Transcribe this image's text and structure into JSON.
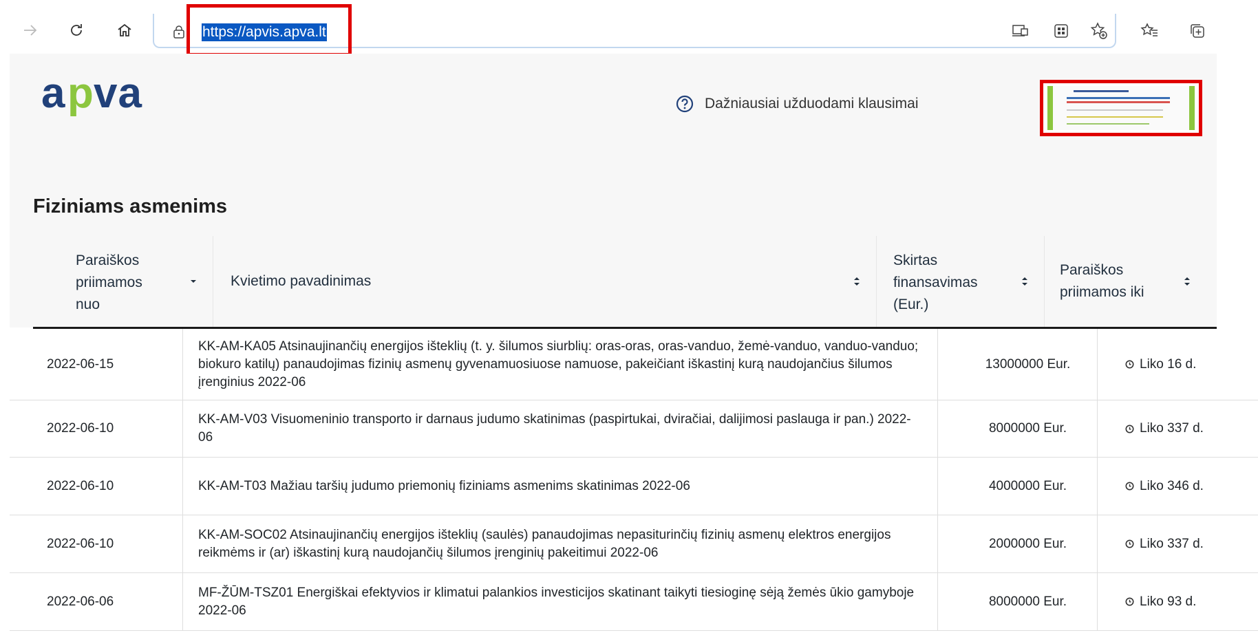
{
  "browser": {
    "url": "https://apvis.apva.lt",
    "icons": [
      "forward-arrow-icon",
      "refresh-icon",
      "home-icon",
      "lock-icon",
      "app-available-icon",
      "qr-code-icon",
      "add-favorite-icon",
      "favorites-icon",
      "collections-icon"
    ]
  },
  "header": {
    "logo_text": "apva",
    "faq_label": "Dažniausiai užduodami klausimai"
  },
  "section": {
    "title": "Fiziniams asmenims"
  },
  "table": {
    "columns": [
      {
        "l1": "Paraiškos",
        "l2": "priimamos",
        "l3": "nuo"
      },
      {
        "l1": "Kvietimo pavadinimas"
      },
      {
        "l1": "Skirtas",
        "l2": "finansavimas",
        "l3": "(Eur.)"
      },
      {
        "l1": "Paraiškos",
        "l2": "priimamos iki"
      }
    ],
    "rows": [
      {
        "date": "2022-06-15",
        "name": "KK-AM-KA05 Atsinaujinančių energijos išteklių (t. y. šilumos siurblių: oras-oras, oras-vanduo, žemė-vanduo, vanduo-vanduo; biokuro katilų) panaudojimas fizinių asmenų gyvenamuosiuose namuose, pakeičiant iškastinį kurą naudojančius šilumos įrenginius 2022-06",
        "funding": "13000000 Eur.",
        "left": "Liko 16 d."
      },
      {
        "date": "2022-06-10",
        "name": "KK-AM-V03 Visuomeninio transporto ir darnaus judumo skatinimas (paspirtukai, dviračiai, dalijimosi paslauga ir pan.) 2022-06",
        "funding": "8000000 Eur.",
        "left": "Liko 337 d."
      },
      {
        "date": "2022-06-10",
        "name": "KK-AM-T03 Mažiau taršių judumo priemonių fiziniams asmenims skatinimas 2022-06",
        "funding": "4000000 Eur.",
        "left": "Liko 346 d."
      },
      {
        "date": "2022-06-10",
        "name": "KK-AM-SOC02 Atsinaujinančių energijos išteklių (saulės) panaudojimas nepasiturinčių fizinių asmenų elektros energijos reikmėms ir (ar) iškastinį kurą naudojančių šilumos įrenginių pakeitimui 2022-06",
        "funding": "2000000 Eur.",
        "left": "Liko 337 d."
      },
      {
        "date": "2022-06-06",
        "name": "MF-ŽŪM-TSZ01 Energiškai efektyvios ir klimatui palankios investicijos skatinant taikyti tiesioginę sėją žemės ūkio gamyboje 2022-06",
        "funding": "8000000 Eur.",
        "left": "Liko 93 d."
      }
    ]
  },
  "colors": {
    "brand_blue": "#21417a",
    "brand_green": "#8cc63f",
    "highlight_red": "#e00000",
    "url_selection": "#0a58c2"
  }
}
